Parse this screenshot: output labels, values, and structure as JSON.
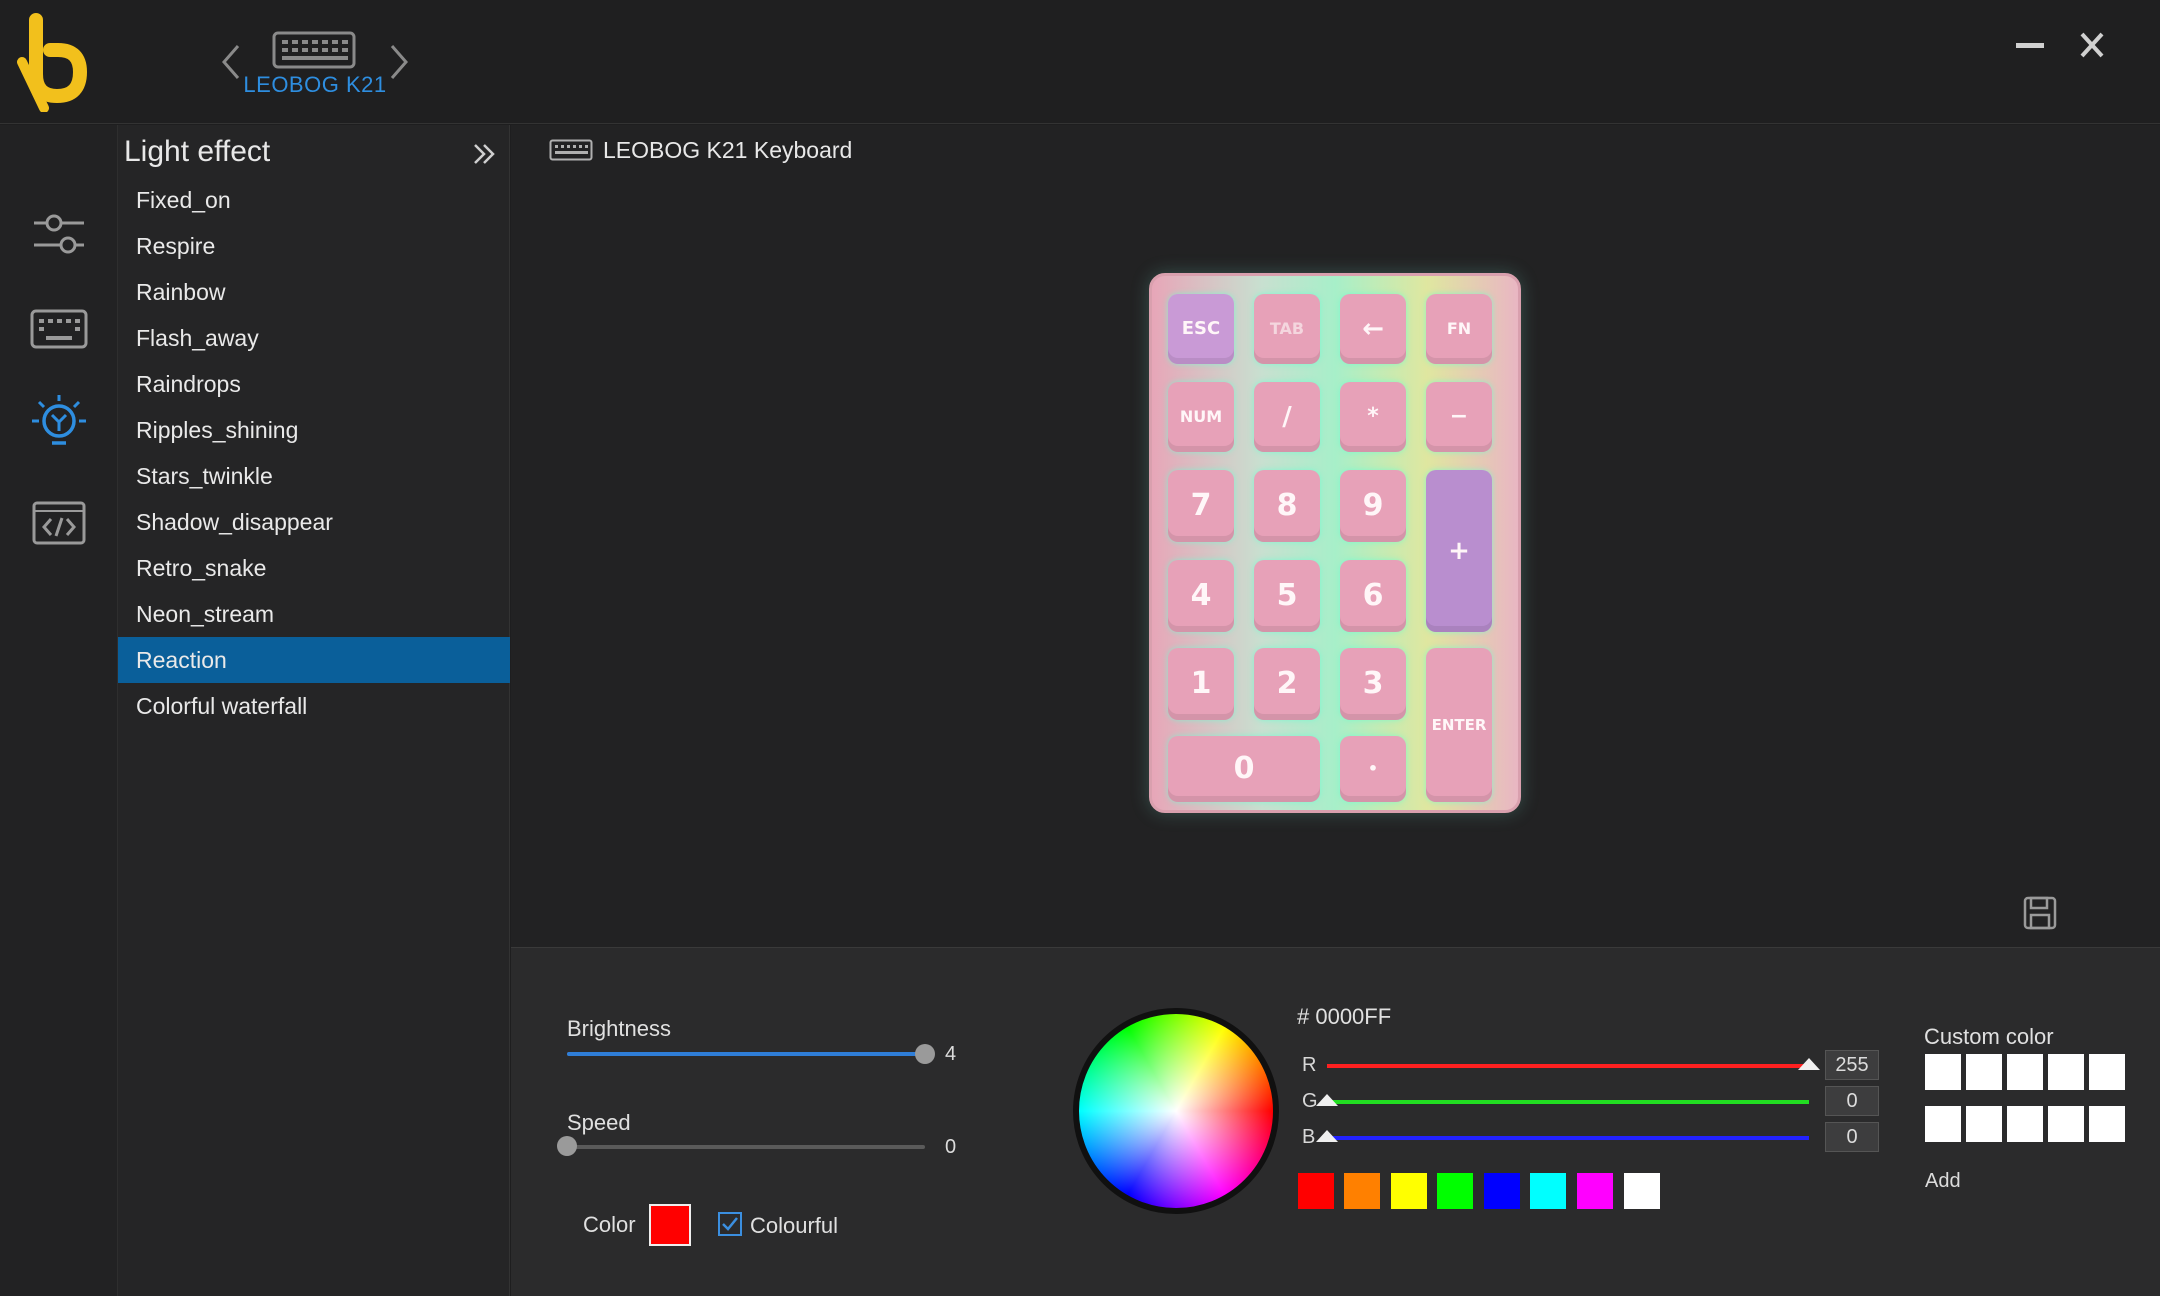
{
  "app": {
    "device_name": "LEOBOG K21"
  },
  "effects_panel": {
    "title": "Light effect",
    "items": [
      "Fixed_on",
      "Respire",
      "Rainbow",
      "Flash_away",
      "Raindrops",
      "Ripples_shining",
      "Stars_twinkle",
      "Shadow_disappear",
      "Retro_snake",
      "Neon_stream",
      "Reaction",
      "Colorful waterfall"
    ],
    "selected": "Reaction"
  },
  "main": {
    "title": "LEOBOG K21 Keyboard",
    "keys": [
      "ESC",
      "TAB",
      "←",
      "FN",
      "NUM",
      "/",
      "*",
      "−",
      "7",
      "8",
      "9",
      "+",
      "4",
      "5",
      "6",
      "1",
      "2",
      "3",
      "ENTER",
      "0",
      "•"
    ]
  },
  "controls": {
    "brightness": {
      "label": "Brightness",
      "value": "4",
      "level": 1.0
    },
    "speed": {
      "label": "Speed",
      "value": "0",
      "level": 0.0
    },
    "color_label": "Color",
    "color_value": "#FF0000",
    "colourful_label": "Colourful",
    "colourful_checked": true,
    "hex": "# 0000FF",
    "rgb": [
      {
        "letter": "R",
        "value": "255",
        "color": "#ff2020",
        "level": 1.0
      },
      {
        "letter": "G",
        "value": "0",
        "color": "#22dd22",
        "level": 0.0
      },
      {
        "letter": "B",
        "value": "0",
        "color": "#2222ff",
        "level": 0.0
      }
    ],
    "presets": [
      "#ff0000",
      "#ff8000",
      "#ffff00",
      "#00ff00",
      "#0000ff",
      "#00ffff",
      "#ff00ff",
      "#ffffff"
    ],
    "custom_color_title": "Custom color",
    "custom_colors": [
      "#ffffff",
      "#ffffff",
      "#ffffff",
      "#ffffff",
      "#ffffff",
      "#ffffff",
      "#ffffff",
      "#ffffff",
      "#ffffff",
      "#ffffff"
    ],
    "add_label": "Add"
  },
  "colors": {
    "accent": "#2e8ee0",
    "selected_bg": "#0a5f9a",
    "logo_yellow": "#f2c01c"
  }
}
